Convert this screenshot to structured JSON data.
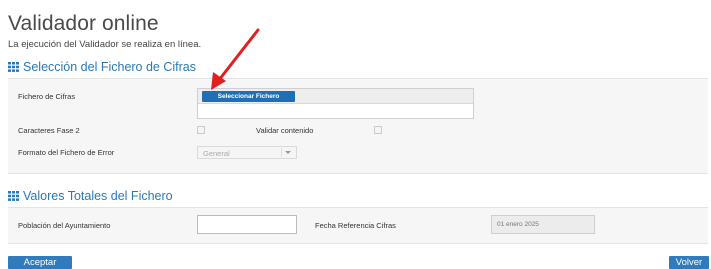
{
  "page": {
    "title": "Validador online",
    "subtitle": "La ejecución del Validador se realiza en línea."
  },
  "section_file": {
    "title": "Selección del Fichero de Cifras",
    "icon": "grid-icon",
    "file_label": "Fichero de Cifras",
    "select_file_button": "Seleccionar Fichero",
    "chars_label": "Caracteres Fase 2",
    "chars_checked": false,
    "validate_label": "Validar contenido",
    "validate_checked": false,
    "error_format_label": "Formato del Fichero de Error",
    "error_format_value": "General"
  },
  "section_totals": {
    "title": "Valores Totales del Fichero",
    "icon": "grid-icon",
    "population_label": "Población del Ayuntamiento",
    "population_value": "",
    "date_label": "Fecha Referencia Cifras",
    "date_value": "01 enero 2025"
  },
  "actions": {
    "accept": "Aceptar",
    "back": "Volver"
  },
  "colors": {
    "accent": "#2f7bbd",
    "section_title": "#2a79b6",
    "annotation_arrow": "#e02020"
  }
}
